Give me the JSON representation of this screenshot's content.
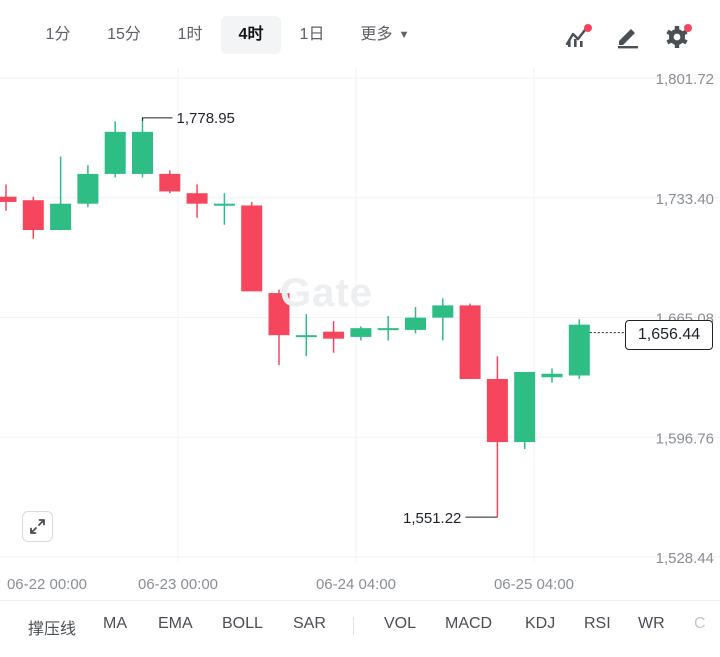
{
  "timeframes": [
    {
      "label": "1分",
      "active": false
    },
    {
      "label": "15分",
      "active": false
    },
    {
      "label": "1时",
      "active": false
    },
    {
      "label": "4时",
      "active": true
    },
    {
      "label": "1日",
      "active": false
    }
  ],
  "more_label": "更多",
  "toolbar_icons": [
    "indicator-chart-icon",
    "draw-pen-icon",
    "settings-gear-icon"
  ],
  "watermark": "Gate",
  "chart_data": {
    "type": "candlestick",
    "y_ticks": [
      "1,801.72",
      "1,733.40",
      "1,665.08",
      "1,596.76",
      "1,528.44"
    ],
    "y_tick_values": [
      1801.72,
      1733.4,
      1665.08,
      1596.76,
      1528.44
    ],
    "x_ticks": [
      "06-22 00:00",
      "06-23 00:00",
      "06-24 04:00",
      "06-25 04:00"
    ],
    "high_label": "1,778.95",
    "low_label": "1,551.22",
    "last_price": "1,656.44",
    "up_color": "#2ebd85",
    "down_color": "#f6465d",
    "candles": [
      {
        "o": 1734,
        "h": 1741,
        "l": 1726,
        "c": 1731
      },
      {
        "o": 1732,
        "h": 1734,
        "l": 1710,
        "c": 1715
      },
      {
        "o": 1715,
        "h": 1757,
        "l": 1715,
        "c": 1730
      },
      {
        "o": 1730,
        "h": 1752,
        "l": 1728,
        "c": 1747
      },
      {
        "o": 1747,
        "h": 1777,
        "l": 1745,
        "c": 1771
      },
      {
        "o": 1747,
        "h": 1779,
        "l": 1745,
        "c": 1771
      },
      {
        "o": 1747,
        "h": 1749,
        "l": 1736,
        "c": 1737
      },
      {
        "o": 1736,
        "h": 1741,
        "l": 1722,
        "c": 1730
      },
      {
        "o": 1729,
        "h": 1736,
        "l": 1718,
        "c": 1730
      },
      {
        "o": 1729,
        "h": 1731,
        "l": 1680,
        "c": 1680
      },
      {
        "o": 1679,
        "h": 1681,
        "l": 1638,
        "c": 1655
      },
      {
        "o": 1655,
        "h": 1667,
        "l": 1643,
        "c": 1655
      },
      {
        "o": 1657,
        "h": 1663,
        "l": 1645,
        "c": 1653
      },
      {
        "o": 1654,
        "h": 1660,
        "l": 1652,
        "c": 1659
      },
      {
        "o": 1659,
        "h": 1666,
        "l": 1652,
        "c": 1659
      },
      {
        "o": 1658,
        "h": 1671,
        "l": 1656,
        "c": 1665
      },
      {
        "o": 1665,
        "h": 1676,
        "l": 1652,
        "c": 1672
      },
      {
        "o": 1672,
        "h": 1673,
        "l": 1630,
        "c": 1630
      },
      {
        "o": 1630,
        "h": 1643,
        "l": 1551.22,
        "c": 1594
      },
      {
        "o": 1594,
        "h": 1634,
        "l": 1590,
        "c": 1634
      },
      {
        "o": 1631,
        "h": 1636,
        "l": 1628,
        "c": 1633
      },
      {
        "o": 1632,
        "h": 1664,
        "l": 1630,
        "c": 1661
      }
    ]
  },
  "indicators": [
    {
      "label": "撑压线"
    },
    {
      "label": "MA"
    },
    {
      "label": "EMA"
    },
    {
      "label": "BOLL"
    },
    {
      "label": "SAR"
    },
    {
      "label": "VOL"
    },
    {
      "label": "MACD"
    },
    {
      "label": "KDJ"
    },
    {
      "label": "RSI"
    },
    {
      "label": "WR"
    },
    {
      "label": "C"
    }
  ]
}
